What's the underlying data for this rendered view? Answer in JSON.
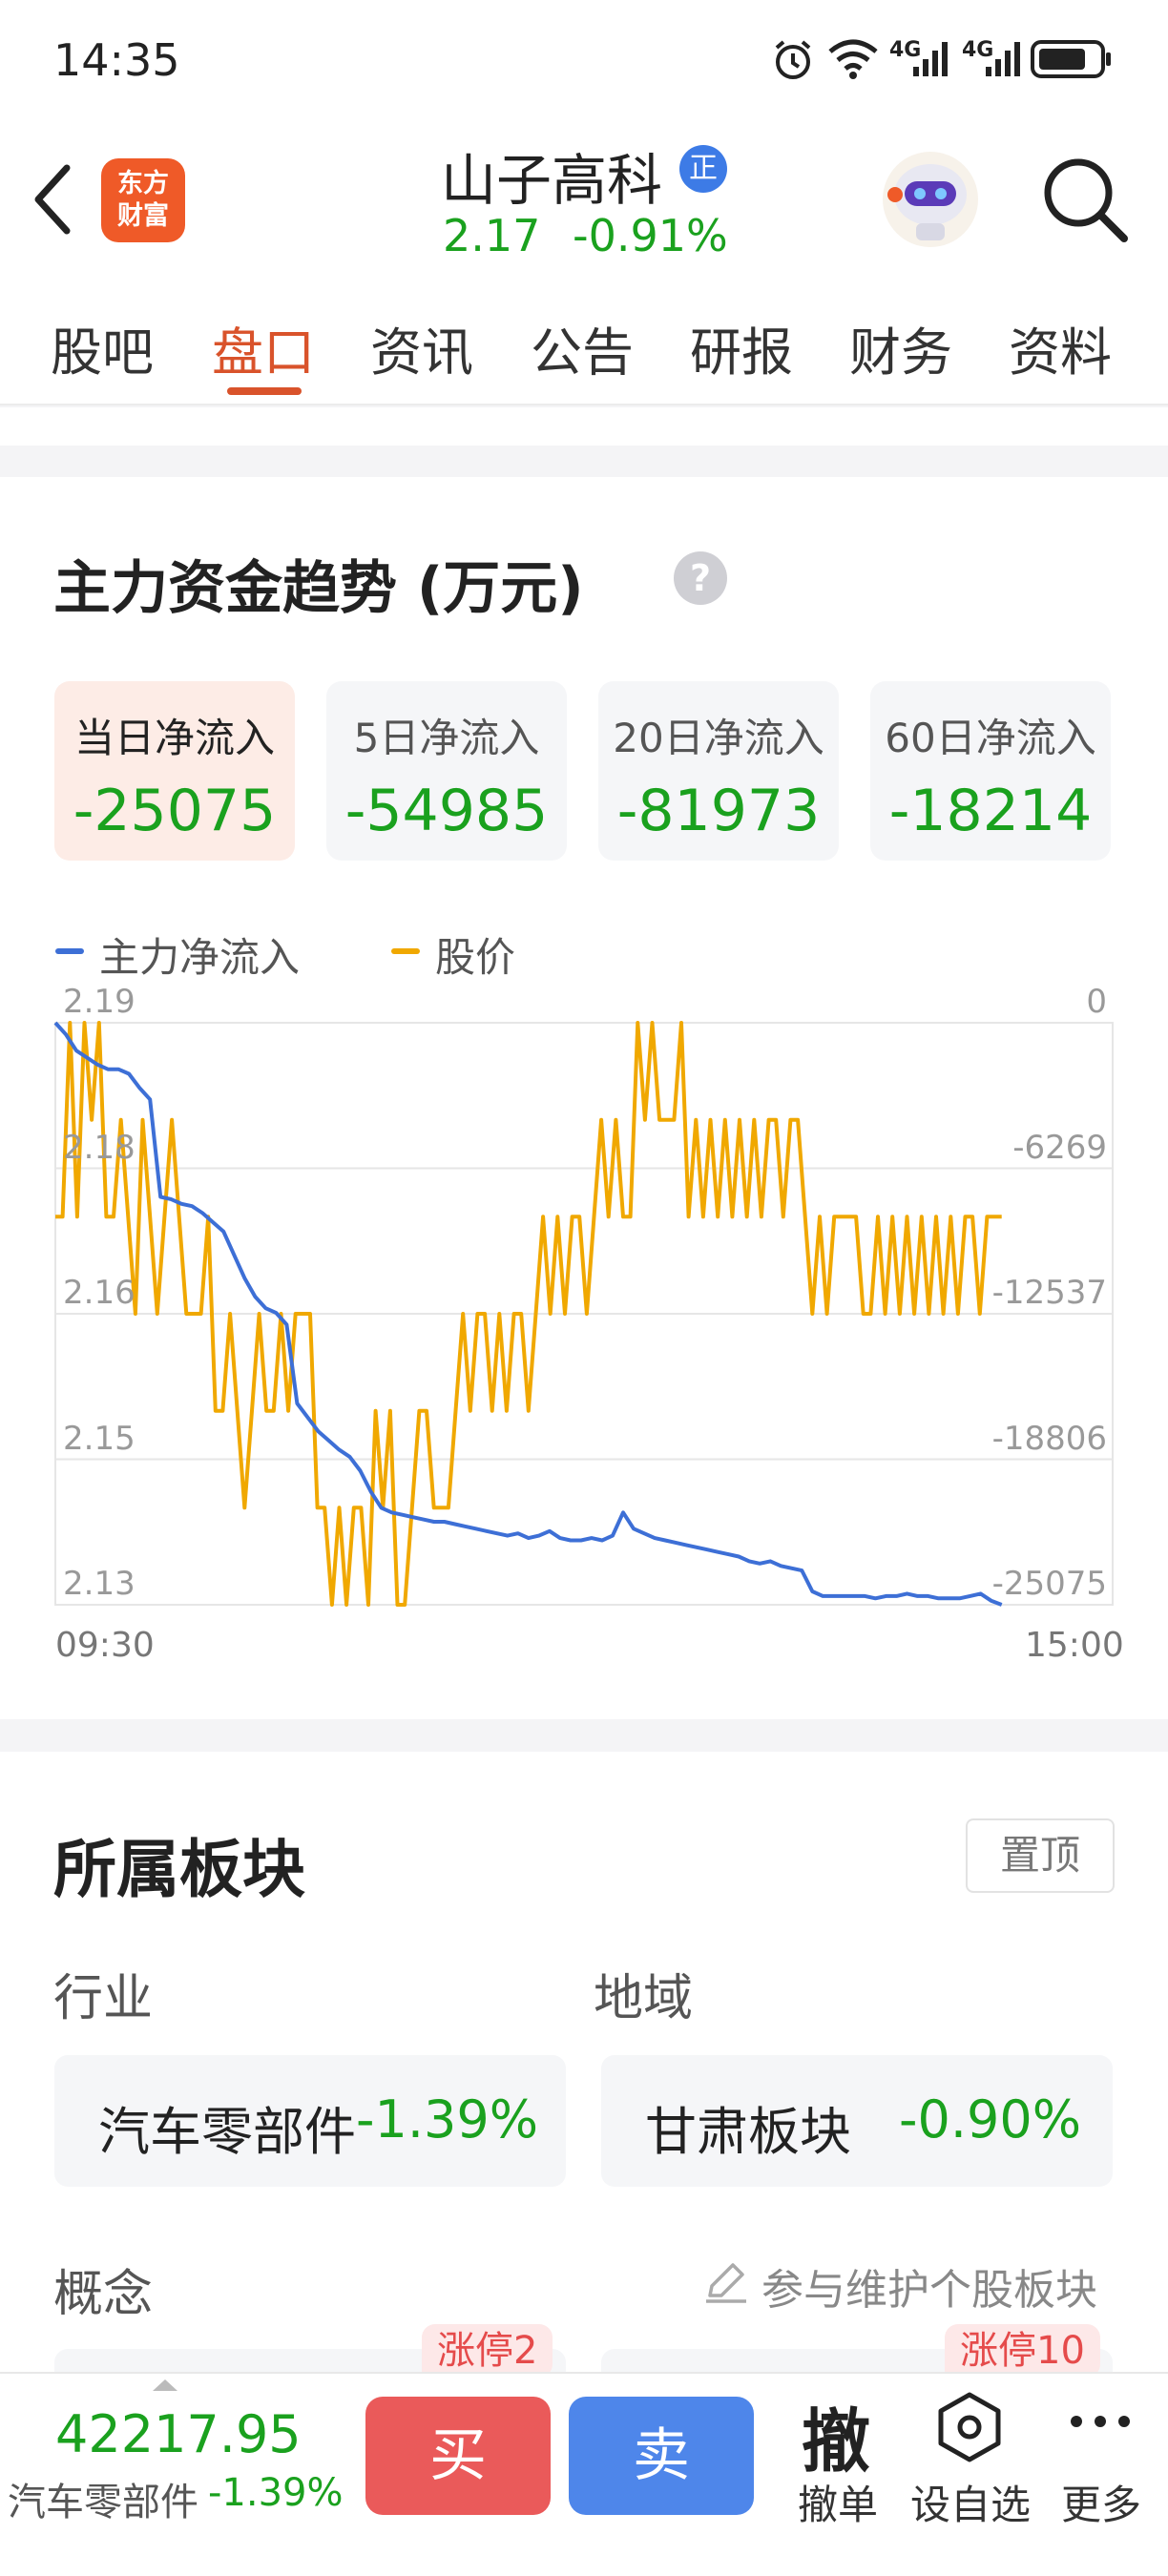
{
  "status_bar": {
    "time": "14:35",
    "network_1": "4G",
    "network_2": "4G"
  },
  "header": {
    "back_icon": "chevron-left-icon",
    "app_logo": [
      "东方",
      "财富"
    ],
    "stock_name": "山子高科",
    "badge": "正",
    "price": "2.17",
    "change_pct": "-0.91%"
  },
  "tabs": [
    {
      "label": "股吧",
      "active": false
    },
    {
      "label": "盘口",
      "active": true
    },
    {
      "label": "资讯",
      "active": false
    },
    {
      "label": "公告",
      "active": false
    },
    {
      "label": "研报",
      "active": false
    },
    {
      "label": "财务",
      "active": false
    },
    {
      "label": "资料",
      "active": false
    }
  ],
  "fund_trend": {
    "title": "主力资金趋势 (万元)",
    "help_icon": "?",
    "boxes": [
      {
        "label": "当日净流入",
        "value": "-25075",
        "active": true
      },
      {
        "label": "5日净流入",
        "value": "-54985",
        "active": false
      },
      {
        "label": "20日净流入",
        "value": "-81973",
        "active": false
      },
      {
        "label": "60日净流入",
        "value": "-18214",
        "active": false
      }
    ]
  },
  "chart_data": {
    "type": "line",
    "title": "",
    "x_start": "09:30",
    "x_end": "15:00",
    "left_ticks": [
      "2.19",
      "2.18",
      "2.16",
      "2.15",
      "2.13"
    ],
    "right_ticks": [
      "0",
      "-6269",
      "-12537",
      "-18806",
      "-25075"
    ],
    "left_ylim": [
      2.13,
      2.19
    ],
    "right_ylim": [
      -25075,
      0
    ],
    "grid": true,
    "legend_position": "top-left",
    "series": [
      {
        "name": "主力净流入",
        "color": "#3d6fd6",
        "axis": "right",
        "values": [
          0,
          -500,
          -1200,
          -1500,
          -1800,
          -2000,
          -2000,
          -2200,
          -2800,
          -3300,
          -7500,
          -7600,
          -7800,
          -7900,
          -8200,
          -8600,
          -9000,
          -10000,
          -11000,
          -11800,
          -12300,
          -12500,
          -13000,
          -16400,
          -17000,
          -17600,
          -18000,
          -18400,
          -18700,
          -19300,
          -20200,
          -20900,
          -21100,
          -21200,
          -21300,
          -21400,
          -21500,
          -21500,
          -21600,
          -21700,
          -21800,
          -21900,
          -22000,
          -22100,
          -22000,
          -22200,
          -22100,
          -21900,
          -22200,
          -22300,
          -22300,
          -22200,
          -22300,
          -22100,
          -21100,
          -21800,
          -22000,
          -22200,
          -22300,
          -22400,
          -22500,
          -22600,
          -22700,
          -22800,
          -22900,
          -23000,
          -23200,
          -23300,
          -23200,
          -23400,
          -23500,
          -23600,
          -24500,
          -24700,
          -24700,
          -24700,
          -24700,
          -24700,
          -24800,
          -24700,
          -24700,
          -24600,
          -24700,
          -24700,
          -24800,
          -24800,
          -24800,
          -24700,
          -24600,
          -24900,
          -25075
        ]
      },
      {
        "name": "股价",
        "color": "#f0a800",
        "axis": "left",
        "values": [
          2.17,
          2.17,
          2.19,
          2.17,
          2.19,
          2.18,
          2.19,
          2.17,
          2.17,
          2.18,
          2.17,
          2.16,
          2.18,
          2.17,
          2.16,
          2.17,
          2.18,
          2.17,
          2.16,
          2.16,
          2.16,
          2.17,
          2.15,
          2.15,
          2.16,
          2.15,
          2.14,
          2.15,
          2.16,
          2.15,
          2.15,
          2.16,
          2.15,
          2.16,
          2.16,
          2.16,
          2.14,
          2.14,
          2.13,
          2.14,
          2.13,
          2.14,
          2.14,
          2.13,
          2.15,
          2.14,
          2.15,
          2.13,
          2.13,
          2.14,
          2.15,
          2.15,
          2.14,
          2.14,
          2.14,
          2.15,
          2.16,
          2.15,
          2.16,
          2.16,
          2.15,
          2.16,
          2.15,
          2.16,
          2.16,
          2.15,
          2.16,
          2.17,
          2.16,
          2.17,
          2.16,
          2.17,
          2.17,
          2.16,
          2.17,
          2.18,
          2.17,
          2.18,
          2.17,
          2.17,
          2.19,
          2.18,
          2.19,
          2.18,
          2.18,
          2.18,
          2.19,
          2.17,
          2.18,
          2.17,
          2.18,
          2.17,
          2.18,
          2.17,
          2.18,
          2.17,
          2.18,
          2.17,
          2.18,
          2.18,
          2.17,
          2.18,
          2.18,
          2.17,
          2.16,
          2.17,
          2.16,
          2.17,
          2.17,
          2.17,
          2.17,
          2.16,
          2.16,
          2.17,
          2.16,
          2.17,
          2.16,
          2.17,
          2.16,
          2.17,
          2.16,
          2.17,
          2.16,
          2.17,
          2.16,
          2.17,
          2.17,
          2.16,
          2.17,
          2.17,
          2.17
        ]
      }
    ]
  },
  "sectors": {
    "title": "所属板块",
    "pin_label": "置顶",
    "industry_label": "行业",
    "region_label": "地域",
    "industry": {
      "name": "汽车零部件",
      "change": "-1.39%"
    },
    "region": {
      "name": "甘肃板块",
      "change": "-0.90%"
    },
    "concept_label": "概念",
    "maintain_label": "参与维护个股板块",
    "limit_badge_1": "涨停2",
    "limit_badge_2": "涨停10"
  },
  "bottom_bar": {
    "index_value": "42217.95",
    "index_name": "汽车零部件",
    "index_change": "-1.39%",
    "buy_label": "买",
    "sell_label": "卖",
    "cancel_glyph": "撤",
    "cancel_label": "撤单",
    "watch_label": "设自选",
    "more_label": "更多"
  }
}
